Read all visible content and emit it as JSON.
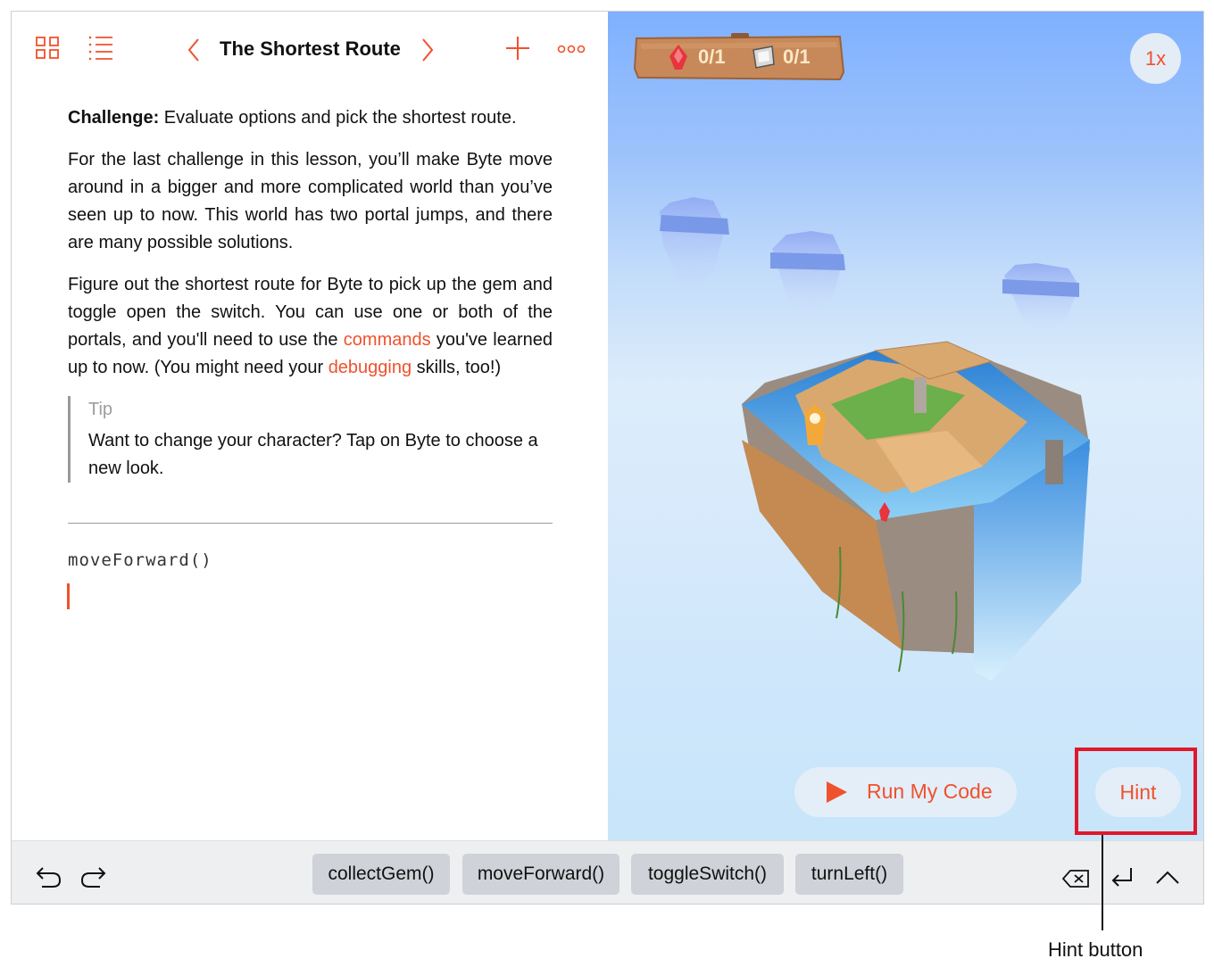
{
  "header": {
    "title": "The Shortest Route"
  },
  "content": {
    "challenge_label": "Challenge:",
    "challenge_text": " Evaluate options and pick the shortest route.",
    "para1": "For the last challenge in this lesson, you’ll make Byte move around in a bigger and more complicated world than you’ve seen up to now. This world has two portal jumps, and there are many possible solutions.",
    "para2_part1": "Figure out the shortest route for Byte to pick up the gem and toggle open the switch. You can use one or both of the portals, and you'll need to use the ",
    "para2_link1": "commands",
    "para2_part2": " you've learned up to now. (You might need your ",
    "para2_link2": "debugging",
    "para2_part3": " skills, too!)",
    "tip_label": "Tip",
    "tip_text": "Want to change your character? Tap on Byte to choose a new look."
  },
  "editor": {
    "code_line": "moveForward()"
  },
  "stage": {
    "gem_count": "0/1",
    "switch_count": "0/1",
    "speed_label": "1x",
    "run_label": "Run My Code",
    "hint_label": "Hint"
  },
  "shortcuts": [
    "collectGem()",
    "moveForward()",
    "toggleSwitch()",
    "turnLeft()"
  ],
  "annotation": {
    "label": "Hint button"
  },
  "colors": {
    "accent": "#f0512d",
    "highlight": "#e0182b"
  },
  "icons": [
    "grid-icon",
    "list-icon",
    "chevron-left-icon",
    "chevron-right-icon",
    "plus-icon",
    "more-icon",
    "undo-icon",
    "redo-icon",
    "delete-icon",
    "return-icon",
    "chevron-up-icon",
    "gem-icon",
    "switch-icon",
    "play-icon"
  ]
}
